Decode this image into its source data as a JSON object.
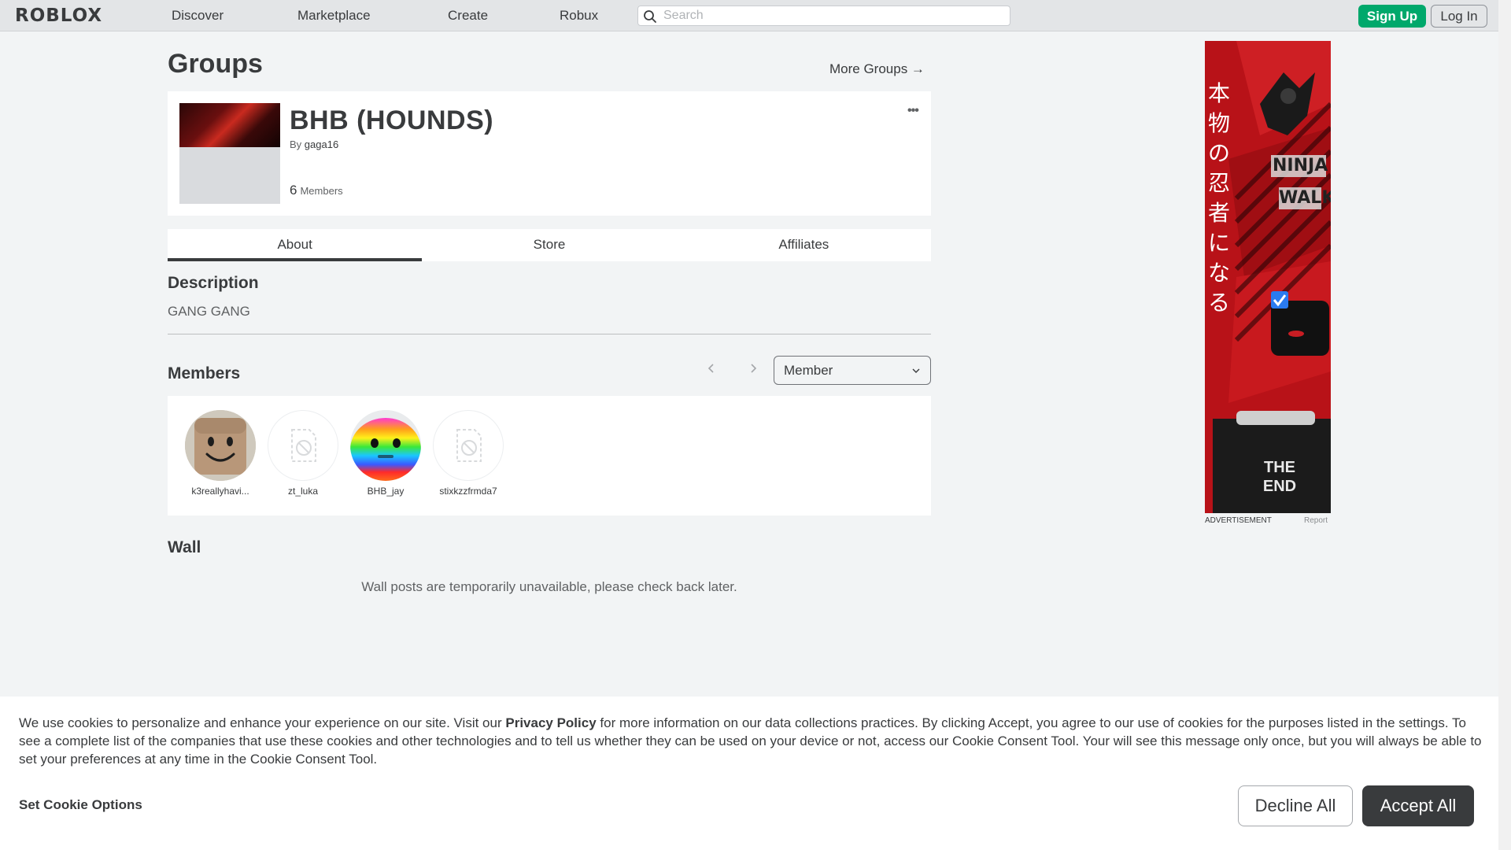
{
  "header": {
    "logo": "ROBLOX",
    "nav": [
      "Discover",
      "Marketplace",
      "Create",
      "Robux"
    ],
    "search_placeholder": "Search",
    "signup_label": "Sign Up",
    "login_label": "Log In"
  },
  "page": {
    "title": "Groups",
    "more_groups": "More Groups →"
  },
  "group": {
    "name": "BHB (HOUNDS)",
    "by_label": "By",
    "owner": "gaga16",
    "member_count": "6",
    "members_label": "Members",
    "menu": "•••"
  },
  "tabs": [
    {
      "label": "About",
      "active": true
    },
    {
      "label": "Store",
      "active": false
    },
    {
      "label": "Affiliates",
      "active": false
    }
  ],
  "description": {
    "title": "Description",
    "text": "GANG GANG"
  },
  "members": {
    "title": "Members",
    "role_selected": "Member",
    "list": [
      {
        "name": "k3reallyhavi...",
        "avatar": "smiley-face"
      },
      {
        "name": "zt_luka",
        "avatar": "placeholder"
      },
      {
        "name": "BHB_jay",
        "avatar": "rainbow-face"
      },
      {
        "name": "stixkzzfrmda7",
        "avatar": "placeholder"
      }
    ]
  },
  "wall": {
    "title": "Wall",
    "message": "Wall posts are temporarily unavailable, please check back later."
  },
  "ad": {
    "label": "ADVERTISEMENT",
    "report": "Report",
    "vertical_text": "本物の忍者になる",
    "brand_line1": "NINJA",
    "brand_line2": "WALK",
    "jacket_text_1": "THE",
    "jacket_text_2": "END"
  },
  "cookie": {
    "text_before": "We use cookies to personalize and enhance your experience on our site. Visit our ",
    "link": "Privacy Policy",
    "text_after": " for more information on our data collections practices. By clicking Accept, you agree to our use of cookies for the purposes listed in the settings. To see a complete list of the companies that use these cookies and other technologies and to tell us whether they can be used on your device or not, access our Cookie Consent Tool. Your will see this message only once, but you will always be able to set your preferences at any time in the Cookie Consent Tool.",
    "options_label": "Set Cookie Options",
    "decline_label": "Decline All",
    "accept_label": "Accept All"
  },
  "colors": {
    "signup": "#00a86b",
    "accept": "#393b3d",
    "ad_red": "#c6151b"
  }
}
